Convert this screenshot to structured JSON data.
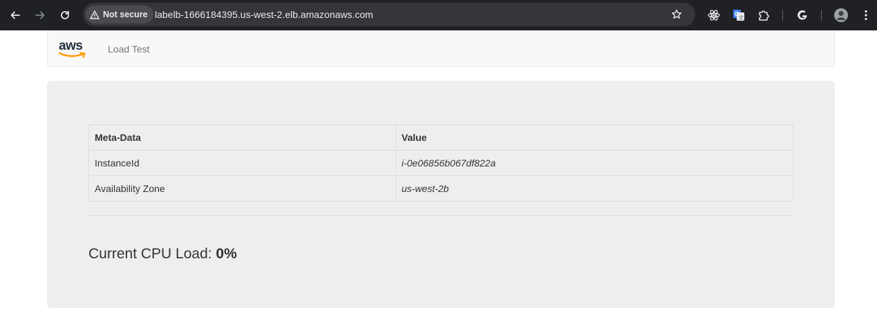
{
  "browser": {
    "security_label": "Not secure",
    "url": "labelb-1666184395.us-west-2.elb.amazonaws.com"
  },
  "navbar": {
    "logo_text": "aws",
    "link": "Load Test"
  },
  "table": {
    "headers": [
      "Meta-Data",
      "Value"
    ],
    "rows": [
      [
        "InstanceId",
        "i-0e06856b067df822a"
      ],
      [
        "Availability Zone",
        "us-west-2b"
      ]
    ]
  },
  "cpu": {
    "label": "Current CPU Load: ",
    "value": "0%"
  },
  "colors": {
    "chrome_bg": "#202124",
    "omnibox_bg": "#35363a",
    "aws_orange": "#ff9900",
    "jumbotron_bg": "#eeeeee"
  },
  "icons": [
    "back-arrow-icon",
    "forward-arrow-icon",
    "reload-icon",
    "warning-triangle-icon",
    "star-icon",
    "react-devtools-icon",
    "google-translate-icon",
    "extensions-puzzle-icon",
    "google-g-icon",
    "profile-avatar-icon",
    "kebab-menu-icon"
  ]
}
